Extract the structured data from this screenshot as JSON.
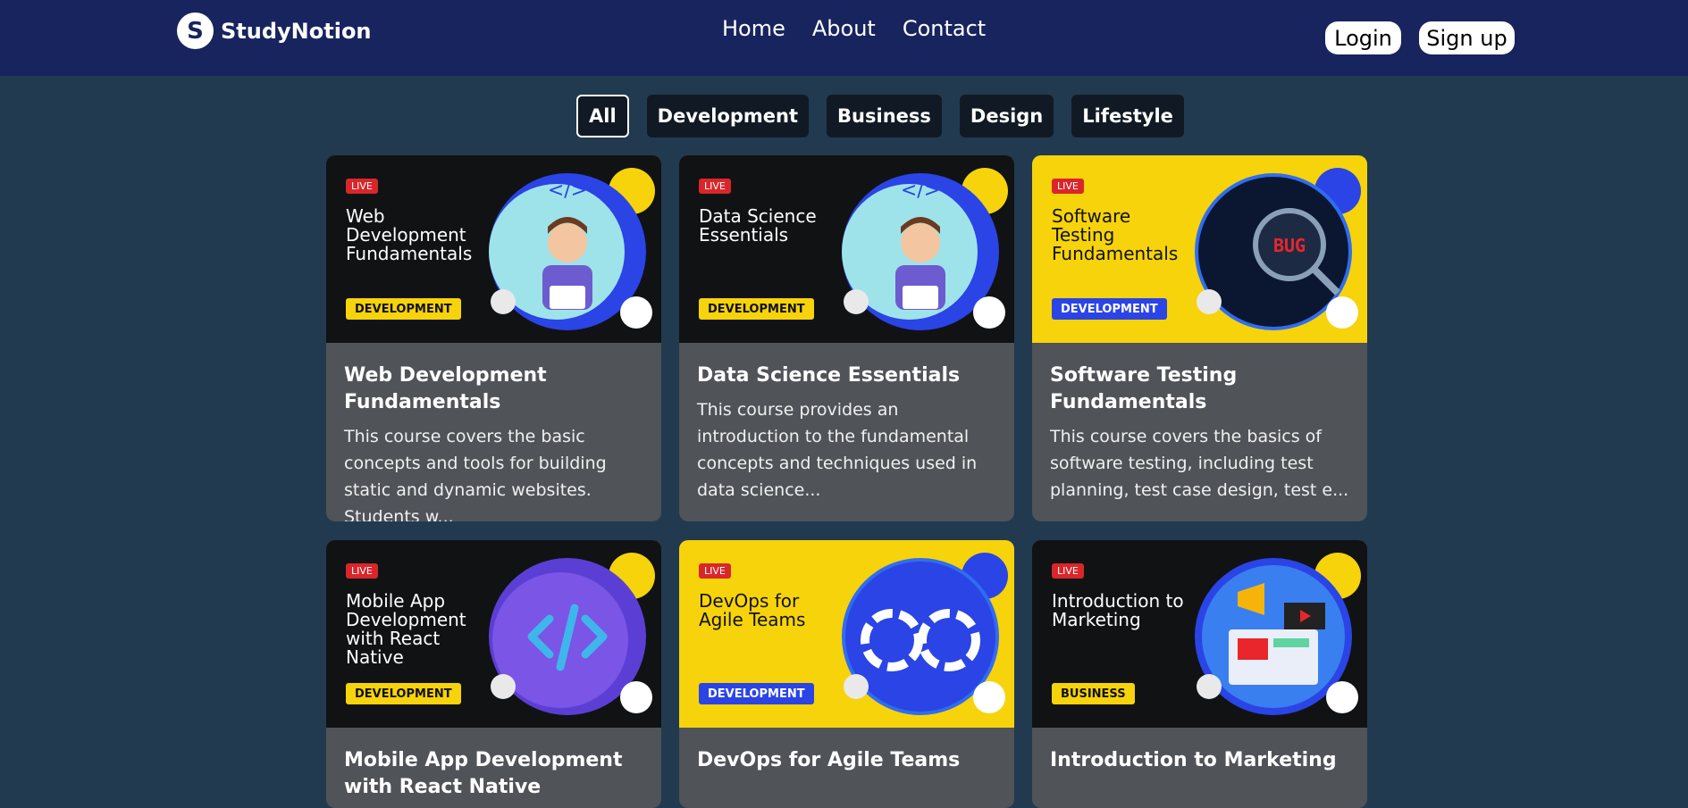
{
  "brand": {
    "name": "StudyNotion",
    "logo_letter": "S"
  },
  "nav": {
    "links": [
      "Home",
      "About",
      "Contact"
    ]
  },
  "auth": {
    "login": "Login",
    "signup": "Sign up"
  },
  "filters": {
    "items": [
      "All",
      "Development",
      "Business",
      "Design",
      "Lifestyle"
    ],
    "active": "All"
  },
  "live_label": "LIVE",
  "courses": [
    {
      "thumb_title": "Web Development Fundamentals",
      "tag": "DEVELOPMENT",
      "title": "Web Development Fundamentals",
      "description": "This course covers the basic concepts and tools for building static and dynamic websites. Students w..."
    },
    {
      "thumb_title": "Data Science Essentials",
      "tag": "DEVELOPMENT",
      "title": "Data Science Essentials",
      "description": "This course provides an introduction to the fundamental concepts and techniques used in data science..."
    },
    {
      "thumb_title": "Software Testing Fundamentals",
      "tag": "DEVELOPMENT",
      "title": "Software Testing Fundamentals",
      "description": "This course covers the basics of software testing, including test planning, test case design, test e..."
    },
    {
      "thumb_title": "Mobile App Development with React Native",
      "tag": "DEVELOPMENT",
      "title": "Mobile App Development with React Native",
      "description": ""
    },
    {
      "thumb_title": "DevOps for Agile Teams",
      "tag": "DEVELOPMENT",
      "title": "DevOps for Agile Teams",
      "description": ""
    },
    {
      "thumb_title": "Introduction to Marketing",
      "tag": "BUSINESS",
      "title": "Introduction to Marketing",
      "description": ""
    }
  ],
  "colors": {
    "nav_bg": "#17245e",
    "page_bg": "#223a4f",
    "card_bg": "#505358",
    "accent_yellow": "#f6d30b",
    "live_red": "#d9262b"
  }
}
